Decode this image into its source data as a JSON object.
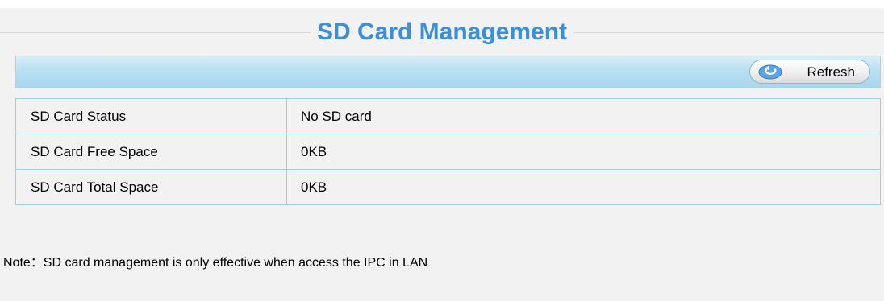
{
  "page": {
    "title": "SD Card Management"
  },
  "toolbar": {
    "refresh_label": "Refresh",
    "refresh_icon": "refresh-icon"
  },
  "table": {
    "rows": [
      {
        "label": "SD Card Status",
        "value": "No SD card"
      },
      {
        "label": "SD Card Free Space",
        "value": "0KB"
      },
      {
        "label": "SD Card Total Space",
        "value": "0KB"
      }
    ]
  },
  "note": {
    "text": "Note：SD card management is only effective when access the IPC in LAN"
  },
  "colors": {
    "title": "#3a8fd8",
    "toolbar": "#b9e0f2",
    "border": "#9dcfe6",
    "background": "#f2f2f2"
  }
}
